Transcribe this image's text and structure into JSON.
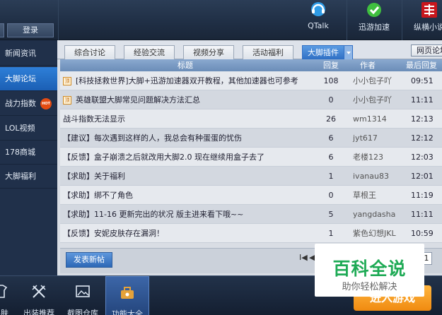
{
  "topbar": {
    "login_label": "登录",
    "apps": [
      {
        "label": "QTalk",
        "icon": "qtalk-icon"
      },
      {
        "label": "迅游加速",
        "icon": "xunyou-icon"
      },
      {
        "label": "纵横小说",
        "icon": "zongheng-icon"
      }
    ]
  },
  "sidebar": {
    "items": [
      {
        "label": "新闻资讯"
      },
      {
        "label": "大脚论坛"
      },
      {
        "label": "战力指数",
        "badge": "HOT"
      },
      {
        "label": "LOL视频"
      },
      {
        "label": "178商城"
      },
      {
        "label": "大脚福利"
      }
    ]
  },
  "forum": {
    "tabs": [
      "综合讨论",
      "经验交流",
      "视频分享",
      "活动福利",
      "大脚插件"
    ],
    "web_button": "网页论坛",
    "columns": {
      "title": "标题",
      "replies": "回复",
      "author": "作者",
      "last_reply": "最后回复"
    },
    "rows": [
      {
        "pinned": true,
        "title": "[科技拯救世界]大脚+迅游加速器双开教程，其他加速器也可参考",
        "replies": "108",
        "author": "小小包子吖",
        "time": "09:51"
      },
      {
        "pinned": true,
        "title": "英雄联盟大脚常见问题解决方法汇总",
        "replies": "0",
        "author": "小小包子吖",
        "time": "11:11"
      },
      {
        "pinned": false,
        "title": "战斗指数无法显示",
        "replies": "26",
        "author": "wm1314",
        "time": "12:13"
      },
      {
        "pinned": false,
        "title": "【建议】每次遇到这样的人，我总会有种蛋蛋的忧伤",
        "replies": "6",
        "author": "jyt617",
        "time": "12:12"
      },
      {
        "pinned": false,
        "title": "【反馈】盒子崩溃之后就改用大脚2.0 现在继续用盒子去了",
        "replies": "6",
        "author": "老楼123",
        "time": "12:03"
      },
      {
        "pinned": false,
        "title": "【求助】关于福利",
        "replies": "1",
        "author": "ivanau83",
        "time": "12:01"
      },
      {
        "pinned": false,
        "title": "【求助】绑不了角色",
        "replies": "0",
        "author": "草根王",
        "time": "11:19"
      },
      {
        "pinned": false,
        "title": "【求助】11-16 更新完出的状况 版主进来看下哦~~",
        "replies": "5",
        "author": "yangdasha",
        "time": "11:11"
      },
      {
        "pinned": false,
        "title": "【反馈】安妮皮肤存在漏洞！",
        "replies": "1",
        "author": "紫色幻想JKL",
        "time": "10:59"
      }
    ],
    "new_post_label": "发表新帖",
    "pager": {
      "first": "I◀",
      "prev": "◀",
      "page": "1"
    }
  },
  "bottom_toolbar": {
    "items": [
      {
        "label": "换肤",
        "icon": "skin-icon"
      },
      {
        "label": "出装推荐",
        "icon": "crossed-swords-icon"
      },
      {
        "label": "截图仓库",
        "icon": "picture-icon"
      },
      {
        "label": "功能大全",
        "icon": "toolbox-icon"
      }
    ],
    "enter_game_label": "进入游戏"
  },
  "watermark": {
    "title": "百科全说",
    "subtitle": "助你轻松解决"
  },
  "colors": {
    "accent": "#2f6fc4",
    "enter_game": "#f08a10",
    "hot_badge": "#e34b12",
    "watermark_green": "#1eaa55"
  }
}
